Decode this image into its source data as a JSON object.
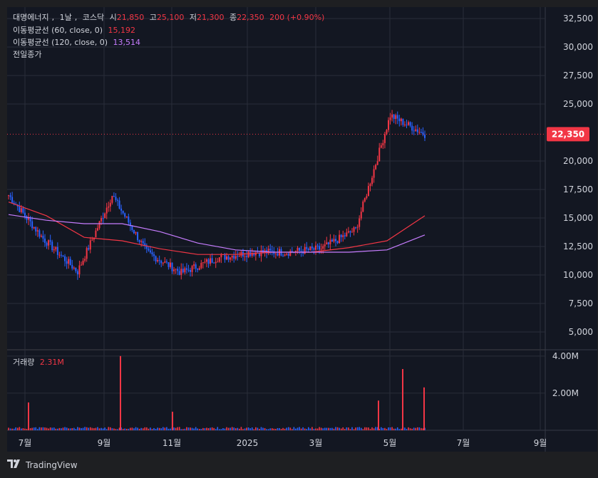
{
  "header": {
    "symbol": "대명에너지",
    "interval": "1날",
    "exchange": "코스닥",
    "open_label": "시",
    "open": "21,850",
    "high_label": "고",
    "high": "25,100",
    "low_label": "저",
    "low": "21,300",
    "close_label": "종",
    "close": "22,350",
    "change": "200 (+0.90%)"
  },
  "indicators": [
    {
      "label": "이동평균선 (60, close, 0)",
      "value": "15,192",
      "color": "#f23645"
    },
    {
      "label": "이동평균선 (120, close, 0)",
      "value": "13,514",
      "color": "#c77dff"
    }
  ],
  "prev_close_label": "전일종가",
  "volume_label": "거래량",
  "volume_value": "2.31M",
  "last_price_badge": "22,350",
  "branding": "TradingView",
  "colors": {
    "up": "#f23645",
    "down": "#2962ff",
    "ma60": "#f23645",
    "ma120": "#c77dff",
    "background": "#131722",
    "grid": "#2a2e39"
  },
  "chart_data": {
    "type": "candlestick",
    "price_axis": {
      "ticks": [
        "32,500",
        "30,000",
        "27,500",
        "25,000",
        "22,350",
        "20,000",
        "17,500",
        "15,000",
        "12,500",
        "10,000",
        "7,500",
        "5,000"
      ],
      "range": [
        3500,
        33500
      ]
    },
    "volume_axis": {
      "ticks": [
        "4.00M",
        "2.00M"
      ],
      "range": [
        0,
        4300000
      ]
    },
    "time_axis": {
      "ticks": [
        "7월",
        "9월",
        "11월",
        "2025",
        "3월",
        "5월",
        "7월",
        "9월"
      ]
    },
    "price_series": [
      {
        "date": "2024-06",
        "close": 17000
      },
      {
        "date": "2024-07",
        "close": 13200
      },
      {
        "date": "2024-08",
        "close": 10300
      },
      {
        "date": "2024-09",
        "close": 17000
      },
      {
        "date": "2024-10",
        "close": 12000
      },
      {
        "date": "2024-11",
        "close": 10200
      },
      {
        "date": "2024-12",
        "close": 11500
      },
      {
        "date": "2025-01",
        "close": 12000
      },
      {
        "date": "2025-02",
        "close": 12000
      },
      {
        "date": "2025-03",
        "close": 12300
      },
      {
        "date": "2025-04",
        "close": 14000
      },
      {
        "date": "2025-05",
        "close": 24000
      },
      {
        "date": "2025-05-end",
        "close": 22350
      }
    ],
    "ma60_series": [
      16400,
      15200,
      13300,
      13000,
      12300,
      11800,
      11800,
      12000,
      12000,
      12400,
      13000,
      15192
    ],
    "ma120_series": [
      15300,
      14800,
      14500,
      14500,
      13800,
      12800,
      12200,
      12000,
      12000,
      12000,
      12200,
      13514
    ],
    "volume_spikes": [
      {
        "date": "2024-06",
        "volume": 1500000
      },
      {
        "date": "2024-09",
        "volume": 4000000
      },
      {
        "date": "2024-11",
        "volume": 1000000
      },
      {
        "date": "2025-04",
        "volume": 1600000
      },
      {
        "date": "2025-05",
        "volume": 3300000
      },
      {
        "date": "2025-05-end",
        "volume": 2310000
      }
    ]
  }
}
